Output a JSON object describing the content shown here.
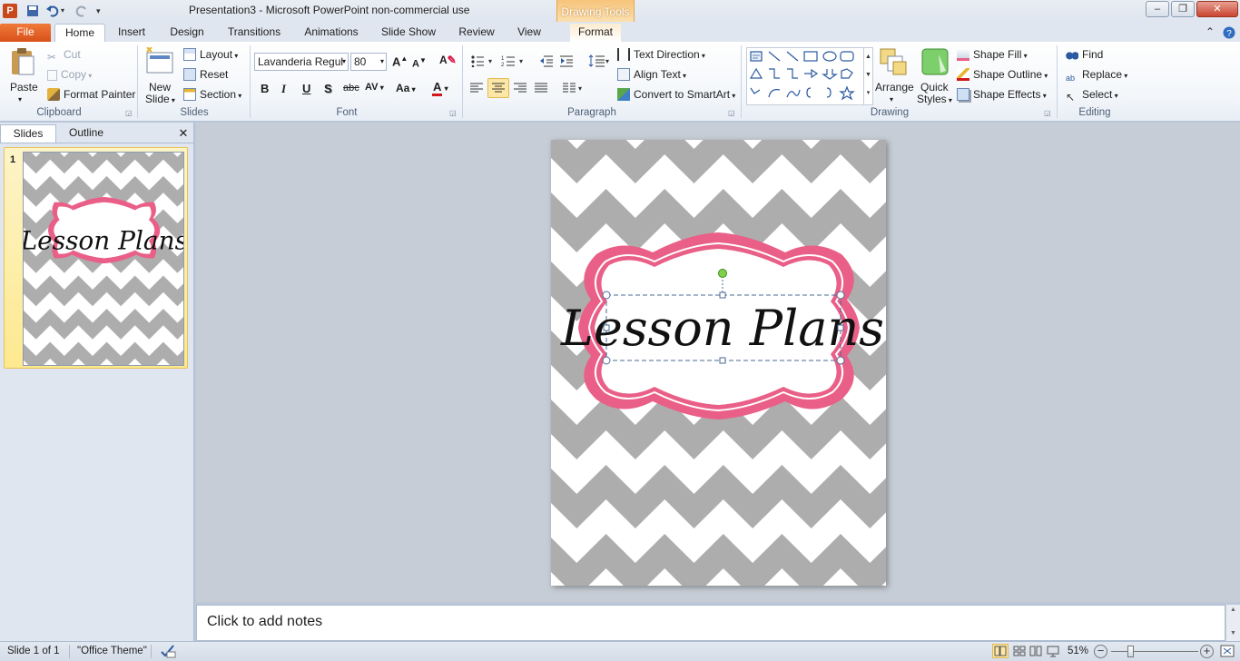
{
  "window": {
    "title": "Presentation3  -  Microsoft PowerPoint non-commercial use",
    "context_group": "Drawing Tools"
  },
  "tabs": [
    "File",
    "Home",
    "Insert",
    "Design",
    "Transitions",
    "Animations",
    "Slide Show",
    "Review",
    "View",
    "Format"
  ],
  "ribbon": {
    "clipboard": {
      "paste": "Paste",
      "cut": "Cut",
      "copy": "Copy",
      "format_painter": "Format Painter",
      "label": "Clipboard"
    },
    "slides": {
      "new_slide_1": "New",
      "new_slide_2": "Slide",
      "layout": "Layout",
      "reset": "Reset",
      "section": "Section",
      "label": "Slides"
    },
    "font": {
      "name": "Lavanderia Regul",
      "size": "80",
      "label": "Font",
      "bold": "B",
      "italic": "I",
      "underline": "U",
      "shadow": "S",
      "strike": "abc",
      "spacing": "AV",
      "case": "Aa"
    },
    "paragraph": {
      "text_direction": "Text Direction",
      "align_text": "Align Text",
      "convert_smartart": "Convert to SmartArt",
      "label": "Paragraph"
    },
    "drawing": {
      "arrange": "Arrange",
      "quick_styles_1": "Quick",
      "quick_styles_2": "Styles",
      "shape_fill": "Shape Fill",
      "shape_outline": "Shape Outline",
      "shape_effects": "Shape Effects",
      "label": "Drawing"
    },
    "editing": {
      "find": "Find",
      "replace": "Replace",
      "select": "Select",
      "label": "Editing"
    }
  },
  "panes": {
    "slides_tab": "Slides",
    "outline_tab": "Outline",
    "slide_number": "1"
  },
  "slide": {
    "title_text": "Lesson Plans"
  },
  "notes": {
    "placeholder": "Click to add notes"
  },
  "status": {
    "slide_info": "Slide 1 of 1",
    "theme": "\"Office Theme\"",
    "zoom": "51%"
  },
  "colors": {
    "accent_pink": "#ea5f87",
    "chevron_gray": "#adadad",
    "file_tab": "#e2632a"
  }
}
